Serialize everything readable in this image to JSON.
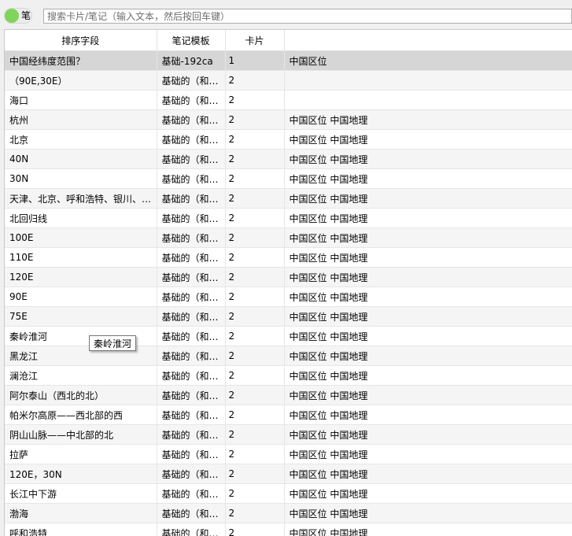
{
  "toolbar": {
    "toggle_label": "笔",
    "search_placeholder": "搜索卡片/笔记（输入文本，然后按回车键）"
  },
  "table": {
    "headers": [
      "排序字段",
      "笔记模板",
      "卡片",
      ""
    ],
    "rows": [
      {
        "sort": "中国经纬度范围？",
        "note": "基础-192ca",
        "cards": "1",
        "tags": "中国区位",
        "selected": true
      },
      {
        "sort": "（90E,30E）",
        "note": "基础的（和…",
        "cards": "2",
        "tags": ""
      },
      {
        "sort": "海口",
        "note": "基础的（和…",
        "cards": "2",
        "tags": ""
      },
      {
        "sort": "杭州",
        "note": "基础的（和…",
        "cards": "2",
        "tags": "中国区位 中国地理"
      },
      {
        "sort": "北京",
        "note": "基础的（和…",
        "cards": "2",
        "tags": "中国区位 中国地理"
      },
      {
        "sort": "40N",
        "note": "基础的（和…",
        "cards": "2",
        "tags": "中国区位 中国地理"
      },
      {
        "sort": "30N",
        "note": "基础的（和…",
        "cards": "2",
        "tags": "中国区位 中国地理"
      },
      {
        "sort": "天津、北京、呼和浩特、银川、…",
        "note": "基础的（和…",
        "cards": "2",
        "tags": "中国区位 中国地理"
      },
      {
        "sort": "北回归线",
        "note": "基础的（和…",
        "cards": "2",
        "tags": "中国区位 中国地理"
      },
      {
        "sort": "100E",
        "note": "基础的（和…",
        "cards": "2",
        "tags": "中国区位 中国地理"
      },
      {
        "sort": "110E",
        "note": "基础的（和…",
        "cards": "2",
        "tags": "中国区位 中国地理"
      },
      {
        "sort": "120E",
        "note": "基础的（和…",
        "cards": "2",
        "tags": "中国区位 中国地理"
      },
      {
        "sort": "90E",
        "note": "基础的（和…",
        "cards": "2",
        "tags": "中国区位 中国地理"
      },
      {
        "sort": "75E",
        "note": "基础的（和…",
        "cards": "2",
        "tags": "中国区位 中国地理"
      },
      {
        "sort": "秦岭淮河",
        "note": "基础的（和…",
        "cards": "2",
        "tags": "中国区位 中国地理"
      },
      {
        "sort": "黑龙江",
        "note": "基础的（和…",
        "cards": "2",
        "tags": "中国区位 中国地理"
      },
      {
        "sort": "澜沧江",
        "note": "基础的（和…",
        "cards": "2",
        "tags": "中国区位 中国地理"
      },
      {
        "sort": "阿尔泰山（西北的北）",
        "note": "基础的（和…",
        "cards": "2",
        "tags": "中国区位 中国地理"
      },
      {
        "sort": "帕米尔高原——西北部的西",
        "note": "基础的（和…",
        "cards": "2",
        "tags": "中国区位 中国地理"
      },
      {
        "sort": "阴山山脉——中北部的北",
        "note": "基础的（和…",
        "cards": "2",
        "tags": "中国区位 中国地理"
      },
      {
        "sort": "拉萨",
        "note": "基础的（和…",
        "cards": "2",
        "tags": "中国区位 中国地理"
      },
      {
        "sort": "120E，30N",
        "note": "基础的（和…",
        "cards": "2",
        "tags": "中国区位 中国地理"
      },
      {
        "sort": "长江中下游",
        "note": "基础的（和…",
        "cards": "2",
        "tags": "中国区位 中国地理"
      },
      {
        "sort": "渤海",
        "note": "基础的（和…",
        "cards": "2",
        "tags": "中国区位 中国地理"
      },
      {
        "sort": "呼和浩特",
        "note": "基础的（和…",
        "cards": "2",
        "tags": "中国区位 中国地理"
      }
    ]
  },
  "tooltip": {
    "text": "秦岭淮河"
  }
}
